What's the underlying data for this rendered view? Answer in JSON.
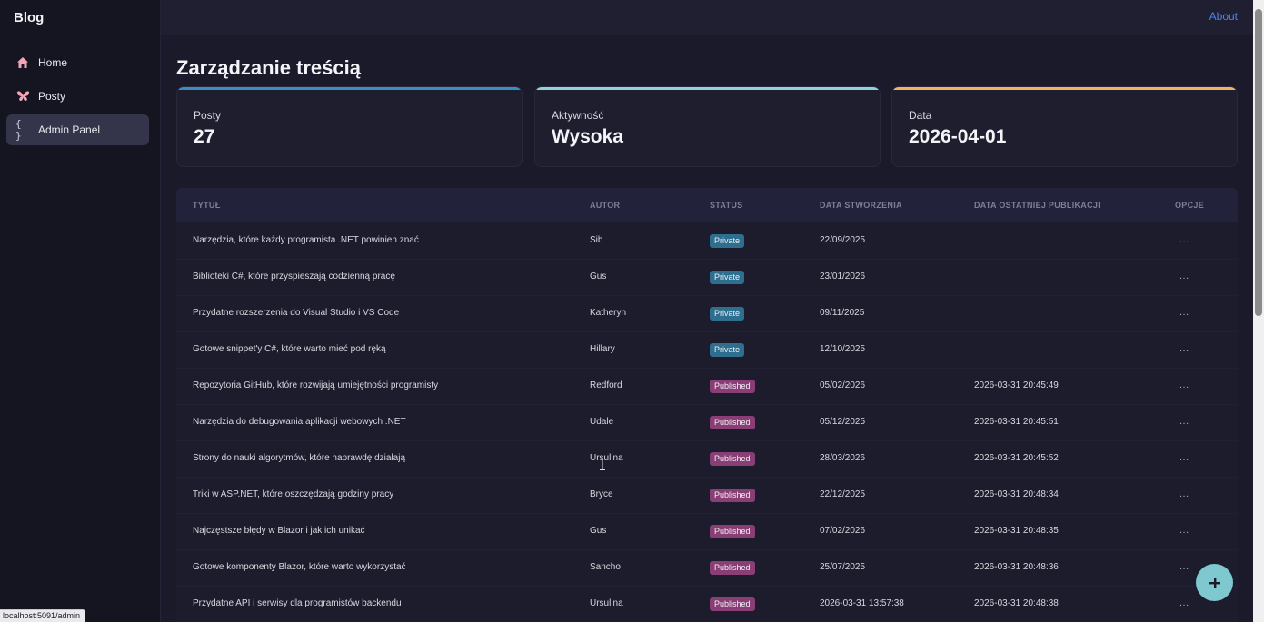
{
  "brand": "Blog",
  "nav": [
    {
      "label": "Home",
      "icon": "home-icon"
    },
    {
      "label": "Posty",
      "icon": "butterfly-icon"
    },
    {
      "label": "Admin Panel",
      "icon": "braces-icon",
      "glyph": "{ }"
    }
  ],
  "topbar": {
    "about_label": "About"
  },
  "page": {
    "title": "Zarządzanie treścią"
  },
  "stats": [
    {
      "label": "Posty",
      "value": "27",
      "accent": "#3a8fbf"
    },
    {
      "label": "Aktywność",
      "value": "Wysoka",
      "accent": "#8fd3db"
    },
    {
      "label": "Data",
      "value": "2026-04-01",
      "accent": "#f2b35e"
    }
  ],
  "table": {
    "columns": [
      "TYTUŁ",
      "AUTOR",
      "STATUS",
      "DATA STWORZENIA",
      "DATA OSTATNIEJ PUBLIKACJI",
      "OPCJE"
    ],
    "rows": [
      {
        "title": "Narzędzia, które każdy programista .NET powinien znać",
        "author": "Sib",
        "status": "Private",
        "created": "22/09/2025",
        "published": "",
        "options": "..."
      },
      {
        "title": "Biblioteki C#, które przyspieszają codzienną pracę",
        "author": "Gus",
        "status": "Private",
        "created": "23/01/2026",
        "published": "",
        "options": "..."
      },
      {
        "title": "Przydatne rozszerzenia do Visual Studio i VS Code",
        "author": "Katheryn",
        "status": "Private",
        "created": "09/11/2025",
        "published": "",
        "options": "..."
      },
      {
        "title": "Gotowe snippet'y C#, które warto mieć pod ręką",
        "author": "Hillary",
        "status": "Private",
        "created": "12/10/2025",
        "published": "",
        "options": "..."
      },
      {
        "title": "Repozytoria GitHub, które rozwijają umiejętności programisty",
        "author": "Redford",
        "status": "Published",
        "created": "05/02/2026",
        "published": "2026-03-31 20:45:49",
        "options": "..."
      },
      {
        "title": "Narzędzia do debugowania aplikacji webowych .NET",
        "author": "Udale",
        "status": "Published",
        "created": "05/12/2025",
        "published": "2026-03-31 20:45:51",
        "options": "..."
      },
      {
        "title": "Strony do nauki algorytmów, które naprawdę działają",
        "author": "Ursulina",
        "status": "Published",
        "created": "28/03/2026",
        "published": "2026-03-31 20:45:52",
        "options": "..."
      },
      {
        "title": "Triki w ASP.NET, które oszczędzają godziny pracy",
        "author": "Bryce",
        "status": "Published",
        "created": "22/12/2025",
        "published": "2026-03-31 20:48:34",
        "options": "..."
      },
      {
        "title": "Najczęstsze błędy w Blazor i jak ich unikać",
        "author": "Gus",
        "status": "Published",
        "created": "07/02/2026",
        "published": "2026-03-31 20:48:35",
        "options": "..."
      },
      {
        "title": "Gotowe komponenty Blazor, które warto wykorzystać",
        "author": "Sancho",
        "status": "Published",
        "created": "25/07/2025",
        "published": "2026-03-31 20:48:36",
        "options": "..."
      },
      {
        "title": "Przydatne API i serwisy dla programistów backendu",
        "author": "Ursulina",
        "status": "Published",
        "created": "2026-03-31 13:57:38",
        "published": "2026-03-31 20:48:38",
        "options": "..."
      }
    ]
  },
  "status_bar": {
    "url": "localhost:5091/admin"
  },
  "fab": {
    "icon": "plus-icon"
  },
  "colors": {
    "private_badge": "#2e6f8f",
    "published_badge": "#8a3e76",
    "link": "#4c86e8",
    "fab": "#7fc8cf"
  }
}
